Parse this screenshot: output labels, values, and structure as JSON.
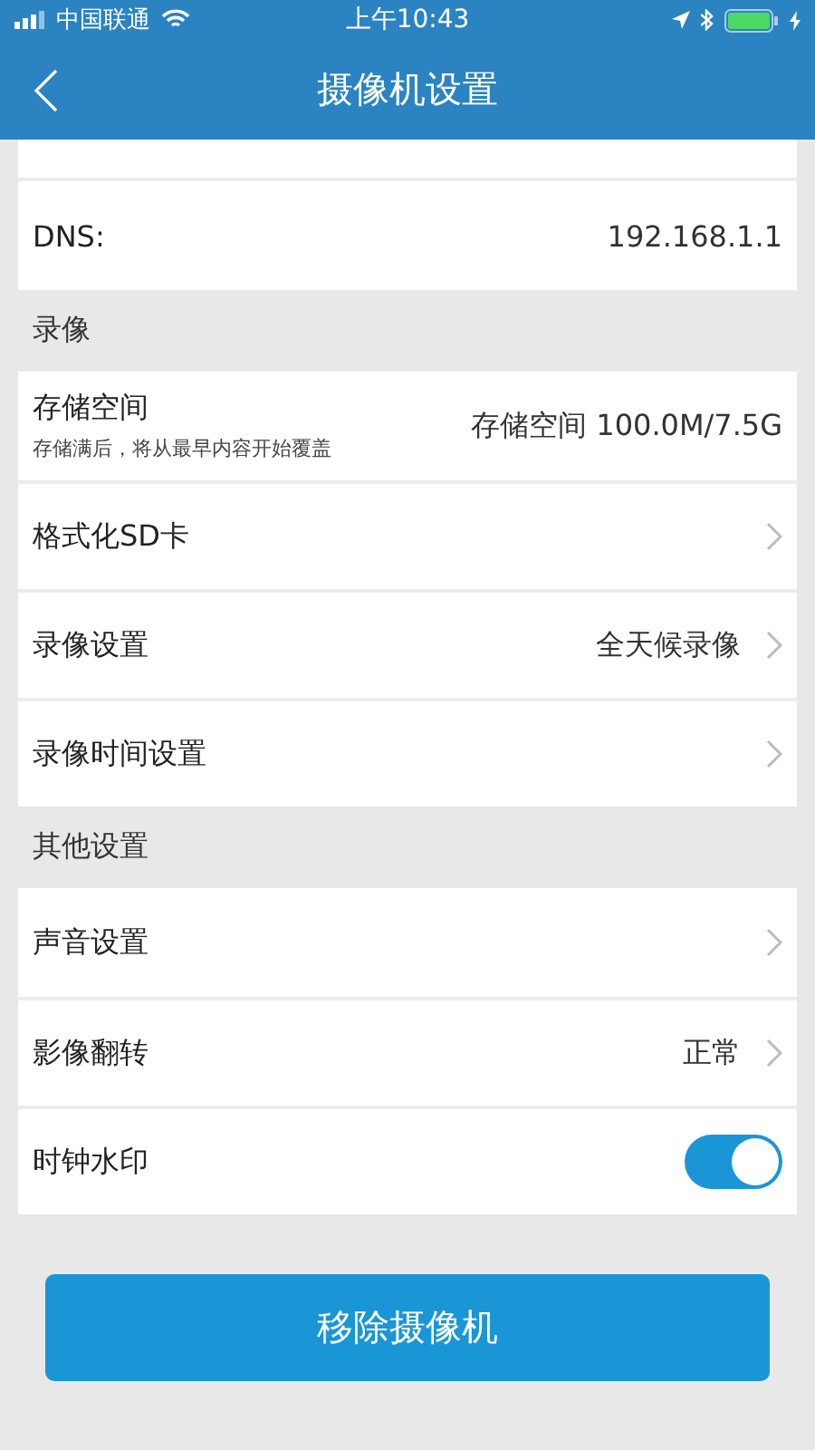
{
  "status_bar": {
    "carrier": "中国联通",
    "time": "上午10:43"
  },
  "header": {
    "title": "摄像机设置"
  },
  "network": {
    "rows": [
      {
        "kind": "value",
        "label": "DNS:",
        "value": "192.168.1.1"
      }
    ]
  },
  "sections": [
    {
      "title": "录像",
      "rows": [
        {
          "kind": "storage",
          "label": "存储空间",
          "hint": "存储满后，将从最早内容开始覆盖",
          "value": "存储空间 100.0M/7.5G"
        },
        {
          "kind": "link",
          "label": "格式化SD卡"
        },
        {
          "kind": "link",
          "label": "录像设置",
          "value": "全天候录像"
        },
        {
          "kind": "link",
          "label": "录像时间设置"
        }
      ]
    },
    {
      "title": "其他设置",
      "rows": [
        {
          "kind": "link",
          "label": "声音设置"
        },
        {
          "kind": "link",
          "label": "影像翻转",
          "value": "正常"
        },
        {
          "kind": "toggle",
          "label": "时钟水印",
          "on": true
        }
      ]
    }
  ],
  "remove_button": "移除摄像机"
}
